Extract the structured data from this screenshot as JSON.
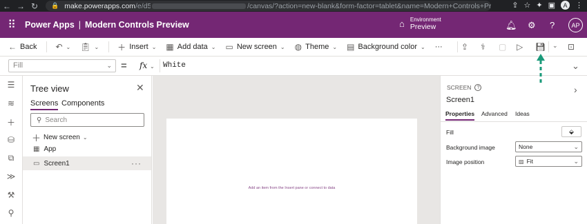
{
  "browser": {
    "url_host": "make.powerapps.com",
    "url_prefix": "/e/d5",
    "url_path": "/canvas/?action=new-blank&form-factor=tablet&name=Modern+Controls+Previ...",
    "profile_initial": "A"
  },
  "header": {
    "app_name": "Power Apps",
    "separator": "|",
    "app_title": "Modern Controls Preview",
    "environment_label": "Environment",
    "environment_name": "Preview",
    "avatar_initials": "AP"
  },
  "commandbar": {
    "back": "Back",
    "insert": "Insert",
    "add_data": "Add data",
    "new_screen": "New screen",
    "theme": "Theme",
    "background_color": "Background color",
    "more": "···"
  },
  "formula": {
    "property": "Fill",
    "fx": "fx",
    "equals": "=",
    "value": "White"
  },
  "tree": {
    "title": "Tree view",
    "tabs": [
      "Screens",
      "Components"
    ],
    "search_placeholder": "Search",
    "new_screen": "New screen",
    "items": [
      {
        "label": "App"
      },
      {
        "label": "Screen1"
      }
    ],
    "more": "···"
  },
  "canvas": {
    "hint_prefix": "Add an item from the Insert pane",
    "hint_or": " or ",
    "hint_link": "connect to data"
  },
  "properties": {
    "kind": "SCREEN",
    "name": "Screen1",
    "tabs": [
      "Properties",
      "Advanced",
      "Ideas"
    ],
    "fill_label": "Fill",
    "background_image_label": "Background image",
    "background_image_value": "None",
    "image_position_label": "Image position",
    "image_position_value": "Fit"
  },
  "colors": {
    "brand": "#742774",
    "annotation": "#1a9a7a"
  }
}
